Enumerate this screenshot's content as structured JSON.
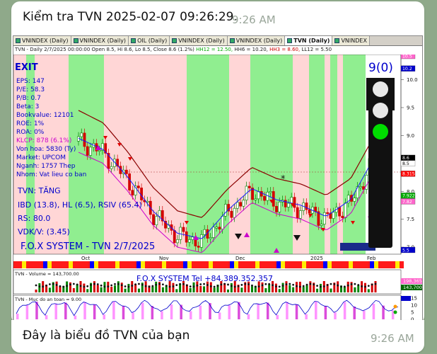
{
  "chat": {
    "top_message": "Kiểm tra TVN 2025-02-07 09:26:29.",
    "top_time": "9:26 AM",
    "bottom_message": "Đây là biểu đồ TVN của bạn",
    "bottom_time": "9:26 AM"
  },
  "tabs": [
    "VNINDEX (Daily)",
    "VNINDEX (Daily)",
    "OIL (Daily)",
    "VNINDEX (Daily)",
    "VNINDEX (Daily)",
    "TVN (Daily)",
    "VNINDEX"
  ],
  "active_tab_index": 5,
  "infobar": {
    "prefix": "TVN - Daily 2/7/2025 00:00:00 Open 8.5, Hi 8.6, Lo 8.5, Close 8.6 (1.2%)",
    "hh12": "HH12 = 12.50,",
    "hh6": "HH6 = 10.20,",
    "hh3": "HH3 = 8.60,",
    "ll12": "LL12 = 5.50"
  },
  "chart_overlay": {
    "exit": "EXIT",
    "eps": "EPS: 147",
    "pe": "P/E: 58.3",
    "pb": "P/B: 0.7",
    "beta": "Beta: 3",
    "bookvalue": "Bookvalue: 12101",
    "roe": "ROE: 1%",
    "roa": "ROA: 0%",
    "klcp": "KLCP: 878 (6.1%)",
    "vonhoa": "Von hoa: 5830 (Ty)",
    "market": "Market: UPCOM",
    "nganh": "Nganh: 1757 Thep",
    "nhom": "Nhom: Vat lieu co ban",
    "trend": "TVN: TĂNG",
    "ibd": "IBD (13.8), HL (6.5), RSIV (65.4)",
    "rs": "RS: 80.0",
    "vdkv": "VDK/V: (3.45)",
    "fox": "F.O.X SYSTEM - TVN 2/7/2025",
    "signal_count": "9(0)",
    "star": "*"
  },
  "axis": {
    "price_ticks": [
      "10.0",
      "9.5",
      "9.0",
      "8.5",
      "8.0",
      "7.5",
      "7.0"
    ],
    "price_tags": [
      "10.5",
      "10.2",
      "8.6",
      "8.5",
      "8.31518",
      "7.92216",
      "7.82",
      "5.5"
    ],
    "months": [
      "Oct",
      "Nov",
      "Dec",
      "2025",
      "Feb"
    ],
    "volume_label": "TVN - Volume = 143,700.00",
    "volume_tags": [
      "198,365",
      "143,700"
    ],
    "fox_tel": "F.O.X SYSTEM Tel +84.389.352.357",
    "safety_label": "TVN - Muc do an toan = 9.00",
    "safety_ticks": [
      "15",
      "10",
      "5",
      "0"
    ]
  },
  "chart_data": {
    "type": "candlestick",
    "x": [
      "Oct",
      "Nov",
      "Dec",
      "2025",
      "Feb"
    ],
    "ylim": [
      6.9,
      10.4
    ],
    "price_close_approx": [
      8.9,
      8.7,
      8.2,
      7.6,
      7.2,
      7.1,
      7.6,
      8.0,
      7.8,
      7.7,
      7.5,
      7.8,
      8.6
    ],
    "last_close": 8.6,
    "hh12": 12.5,
    "hh6": 10.2,
    "hh3": 8.6,
    "ll12": 5.5,
    "volume_last": 143700,
    "volume_ma": 198365,
    "safety_level": 9.0
  },
  "colors": {
    "green_band": "#90ee90",
    "pink_band": "#ffd6d6",
    "up": "#008000",
    "down": "#d40000",
    "accent_blue": "#0000ff",
    "traffic_green": "#00dd00"
  }
}
